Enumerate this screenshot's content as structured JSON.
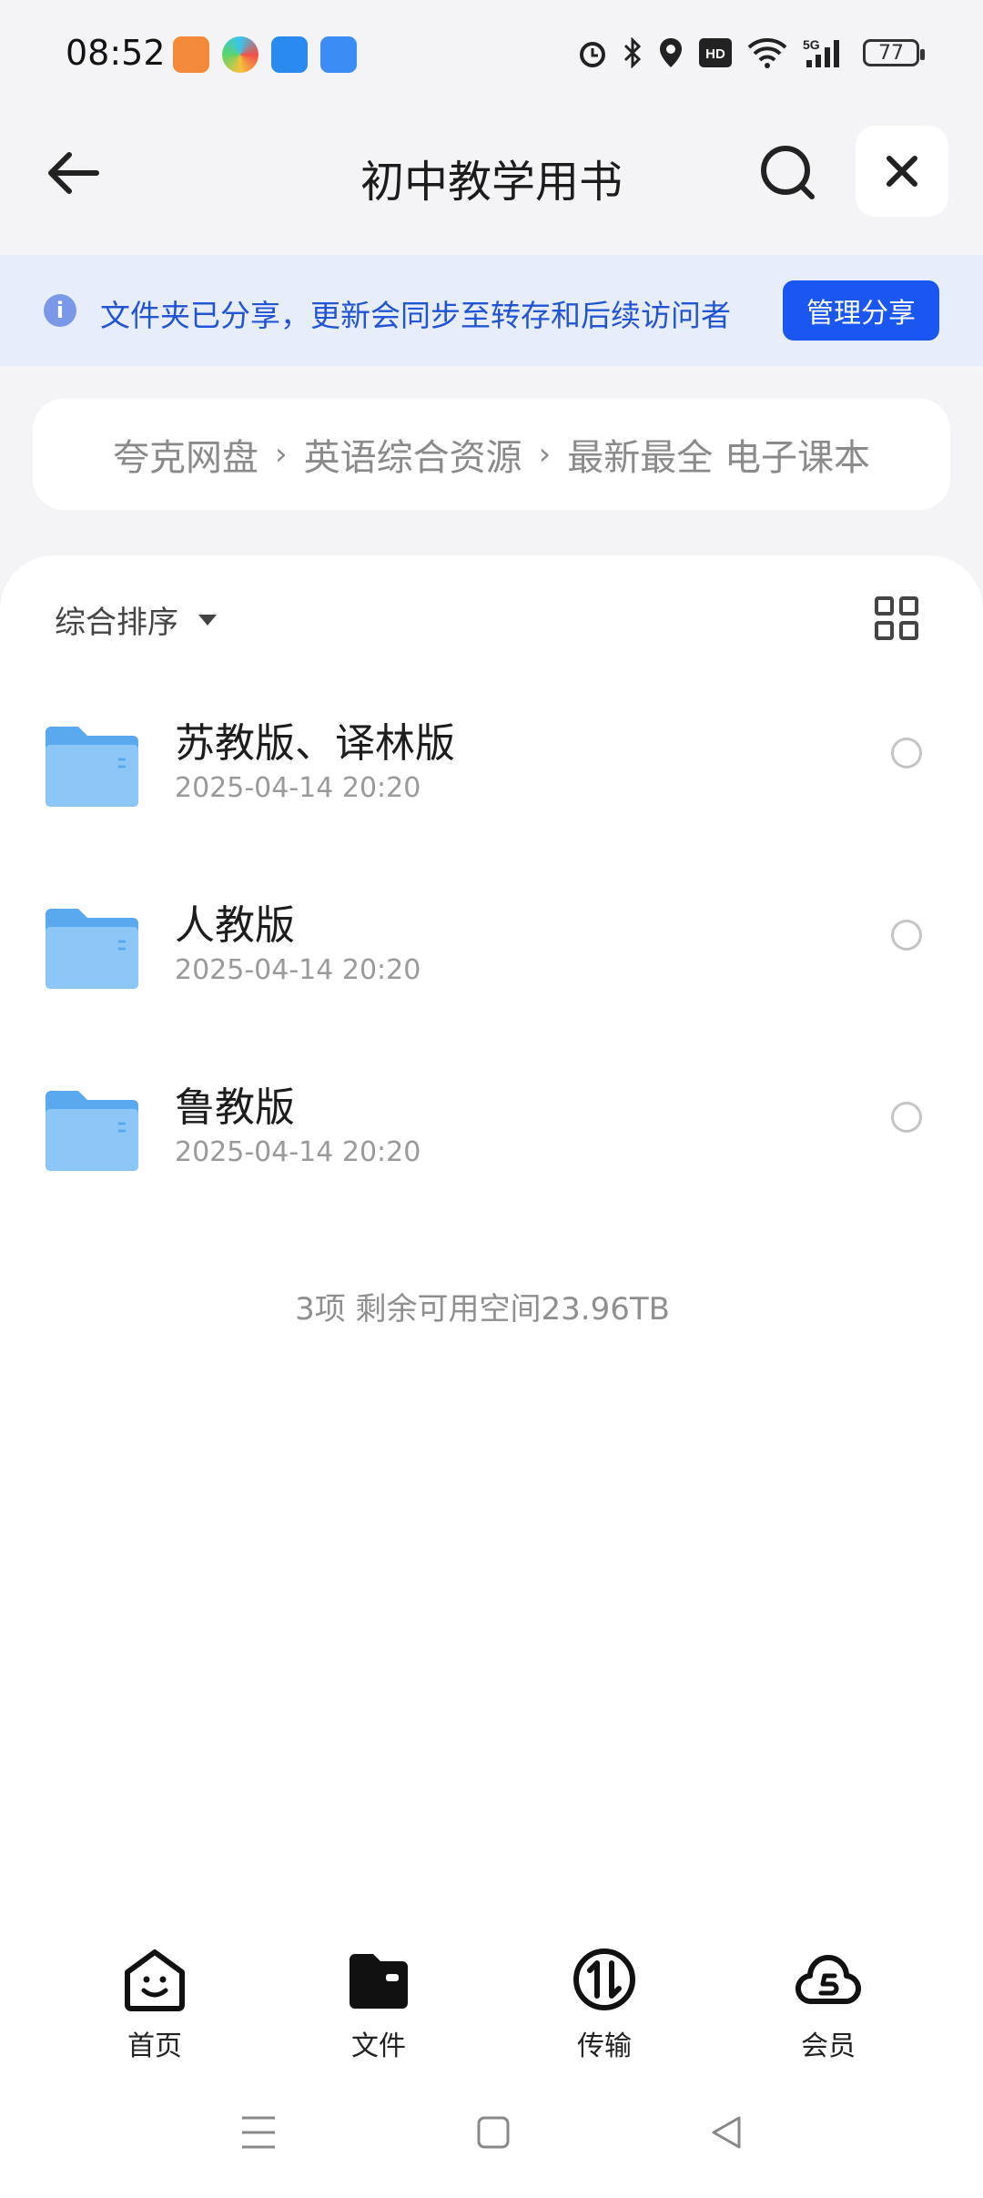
{
  "status_bar": {
    "time": "08:52",
    "icons": [
      "alarm-icon",
      "bluetooth-icon",
      "location-icon",
      "hd-icon",
      "wifi-icon",
      "5g-signal-icon"
    ],
    "battery": "77"
  },
  "header": {
    "title": "初中教学用书",
    "back_icon": "back-arrow-icon",
    "search_icon": "search-icon",
    "close_icon": "close-icon"
  },
  "banner": {
    "text": "文件夹已分享，更新会同步至转存和后续访问者",
    "button": "管理分享"
  },
  "breadcrumb": [
    "夸克网盘",
    "英语综合资源",
    "最新最全 电子课本"
  ],
  "toolbar": {
    "sort_label": "综合排序"
  },
  "files": [
    {
      "name": "苏教版、译林版",
      "date": "2025-04-14 20:20"
    },
    {
      "name": "人教版",
      "date": "2025-04-14 20:20"
    },
    {
      "name": "鲁教版",
      "date": "2025-04-14 20:20"
    }
  ],
  "summary": "3项 剩余可用空间23.96TB",
  "bottom_nav": [
    {
      "label": "首页",
      "icon": "home-face-icon"
    },
    {
      "label": "文件",
      "icon": "folder-wallet-icon"
    },
    {
      "label": "传输",
      "icon": "transfer-icon"
    },
    {
      "label": "会员",
      "icon": "membership-cloud-icon"
    }
  ],
  "colors": {
    "accent": "#1a57f0",
    "banner_bg": "#e8edfb",
    "banner_text": "#2255d6",
    "folder": "#5aa9ef"
  }
}
